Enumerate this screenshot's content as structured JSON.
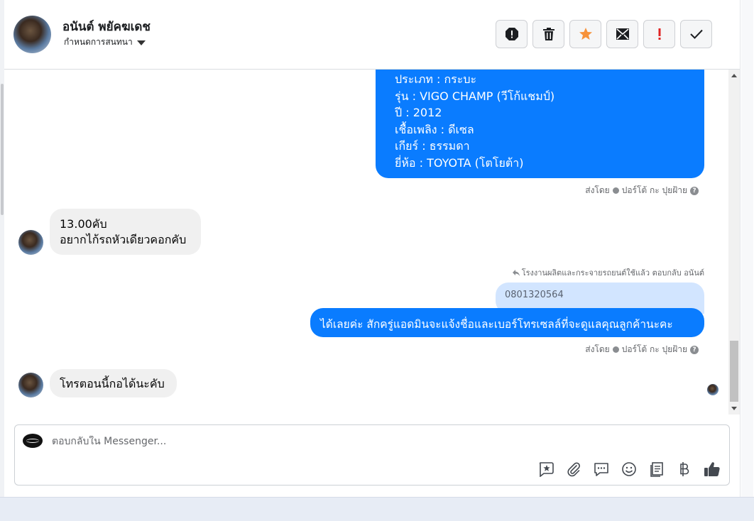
{
  "header": {
    "contact_name": "อนันต์ พยัคฆเดช",
    "assign_label": "กำหนดการสนทนา"
  },
  "toolbar": [
    {
      "name": "report-icon",
      "label": "report"
    },
    {
      "name": "trash-icon",
      "label": "delete"
    },
    {
      "name": "star-icon",
      "label": "star"
    },
    {
      "name": "mark-unread-icon",
      "label": "mark unread"
    },
    {
      "name": "important-icon",
      "label": "important"
    },
    {
      "name": "check-icon",
      "label": "done"
    }
  ],
  "messages": {
    "car_info": {
      "type": "ประเภท : กระบะ",
      "model": "รุ่น : VIGO CHAMP (วีโก้แชมป์)",
      "year": "ปี : 2012",
      "fuel": "เชื้อเพลิง : ดีเซล",
      "gear": "เกียร์ : ธรรมดา",
      "brand": "ยี่ห้อ : TOYOTA (โตโยต้า)"
    },
    "sent_by_1": {
      "prefix": "ส่งโดย",
      "agent": "ปอร์โต้ กะ ปุยฝ้าย"
    },
    "incoming_1": {
      "line1": "13.00คับ",
      "line2": "อยากไก้รถหัวเดียวคอกคับ"
    },
    "reply_note": "โรงงานผลิตและกระจายรถยนต์ใช้แล้ว ตอบกลับ อนันต์",
    "quoted_text": "0801320564",
    "outgoing_2": "ได้เลยค่ะ สักครู่แอดมินจะแจ้งชื่อและเบอร์โทรเซลล์ที่จะดูแลคุณลูกค้านะคะ",
    "sent_by_2": {
      "prefix": "ส่งโดย",
      "agent": "ปอร์โต้ กะ ปุยฝ้าย"
    },
    "incoming_2": "โทรตอนนี้กอได้นะคับ"
  },
  "composer": {
    "placeholder": "ตอบกลับใน Messenger..."
  },
  "colors": {
    "outgoing_bubble": "#0a7cff",
    "incoming_bubble": "#f0f0f0",
    "quoted_bubble": "#d2e5ff",
    "star": "#f7923a",
    "important": "#e02424"
  }
}
